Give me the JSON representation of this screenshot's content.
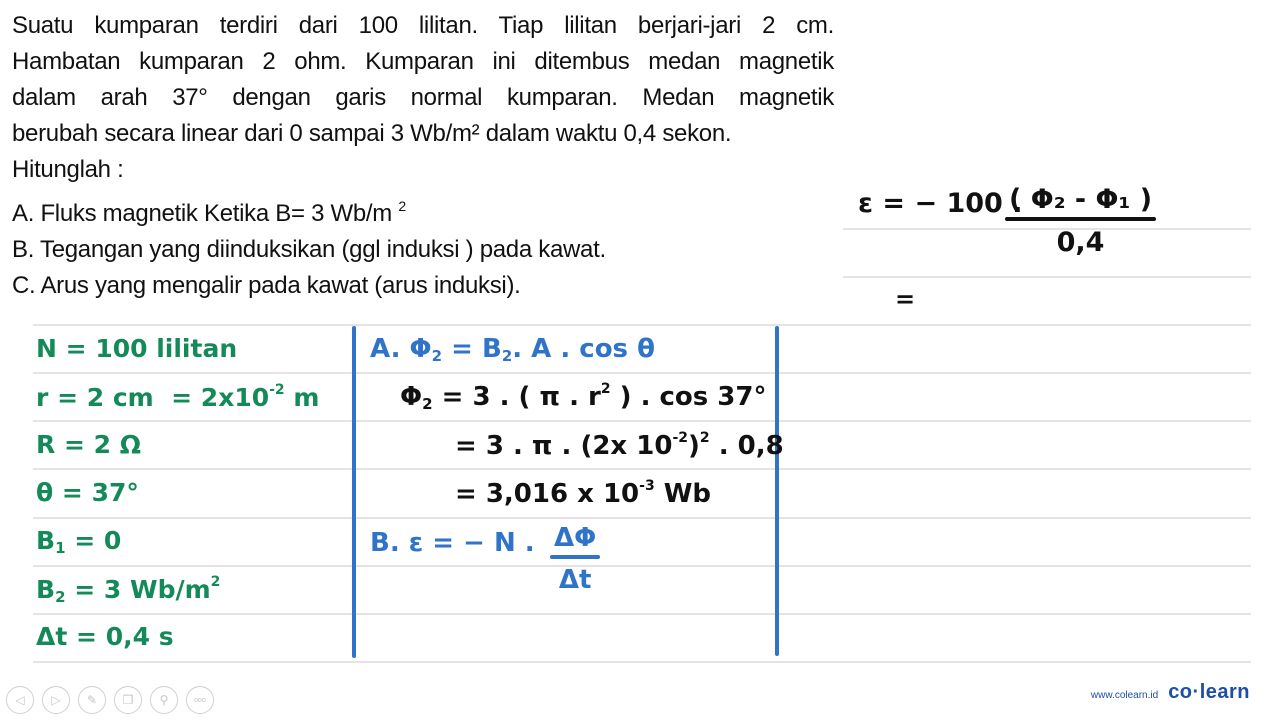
{
  "problem": {
    "lines": [
      "Suatu kumparan terdiri dari 100 lilitan. Tiap lilitan berjari-jari 2 cm.",
      "Hambatan kumparan 2 ohm. Kumparan ini ditembus medan magnetik",
      "dalam arah 37° dengan garis normal kumparan. Medan magnetik",
      "berubah secara linear dari 0 sampai 3 Wb/m² dalam waktu 0,4 sekon."
    ],
    "prompt": "Hitunglah :",
    "questions": [
      {
        "text": "A. Fluks magnetik Ketika B= 3 Wb/m",
        "sup": "2"
      },
      {
        "text": "B. Tegangan yang diinduksikan (ggl induksi ) pada kawat."
      },
      {
        "text": "C. Arus yang mengalir pada kawat (arus induksi)."
      }
    ]
  },
  "known": {
    "N": {
      "lhs": "N",
      "eq": "=",
      "rhs": "100 lilitan"
    },
    "r": {
      "lhs": "r",
      "eq": "=",
      "rhs": "2 cm",
      "eq2": "=",
      "rhs2": "2x10",
      "exp": "-2",
      "unit": "m"
    },
    "R": {
      "lhs": "R",
      "eq": "=",
      "rhs": "2 Ω"
    },
    "theta": {
      "lhs": "θ",
      "eq": "=",
      "rhs": "37°"
    },
    "B1": {
      "lhs": "B",
      "sub": "1",
      "eq": "=",
      "rhs": "0"
    },
    "B2": {
      "lhs": "B",
      "sub": "2",
      "eq": "=",
      "rhs": "3 Wb/m",
      "sup": "2"
    },
    "dt": {
      "lhs": "Δt",
      "eq": "=",
      "rhs": "0,4 s"
    }
  },
  "solution_a": {
    "line1": {
      "label": "A.",
      "phi": "Φ",
      "sub": "2",
      "rest": "=  B",
      "sub2": "2",
      "rest2": ". A . cos θ"
    },
    "line2": {
      "phi": "Φ",
      "sub": "2",
      "rest": "= 3 . ( π . r",
      "sup": "2",
      "rest2": " ) . cos 37°"
    },
    "line3": {
      "pre": "= 3 . π . (2x 10",
      "exp": "-2",
      "mid": ")",
      "sup": "2",
      "post": " . 0,8"
    },
    "line4": {
      "pre": "= 3,016  x 10",
      "exp": "-3",
      "post": " Wb"
    }
  },
  "solution_b": {
    "label": "B.",
    "lhs": "ε = − N .",
    "numerator": "ΔΦ",
    "denominator": "Δt"
  },
  "side_calc": {
    "lhs": "ε =  − 100 .",
    "numerator": "( Φ₂ - Φ₁ )",
    "denominator": "0,4",
    "next": "="
  },
  "toolbar": {
    "items": [
      {
        "name": "previous-icon",
        "glyph": "◁"
      },
      {
        "name": "next-icon",
        "glyph": "▷"
      },
      {
        "name": "pen-icon",
        "glyph": "✎"
      },
      {
        "name": "copy-icon",
        "glyph": "❐"
      },
      {
        "name": "search-icon",
        "glyph": "⚲"
      },
      {
        "name": "more-icon",
        "glyph": "ooo"
      }
    ]
  },
  "brand": {
    "url": "www.colearn.id",
    "logo": "co·learn"
  },
  "colors": {
    "green_ink": "#138a57",
    "blue_ink": "#2f74c8",
    "black_ink": "#111111",
    "ruled_line": "#e4e4e4",
    "brand": "#1d4fa3"
  }
}
